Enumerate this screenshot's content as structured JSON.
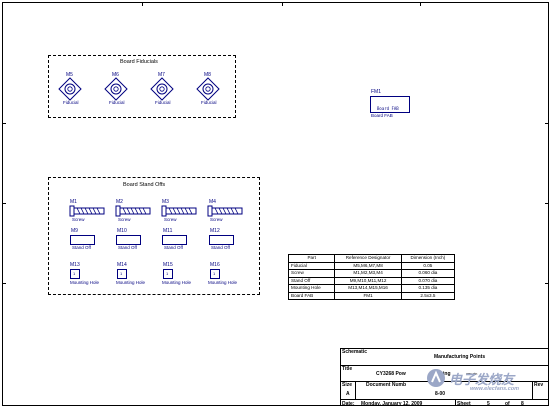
{
  "fiducials": {
    "title": "Board Fiducials",
    "items": [
      {
        "designator": "M5",
        "label": "Fiducial"
      },
      {
        "designator": "M6",
        "label": "Fiducial"
      },
      {
        "designator": "M7",
        "label": "Fiducial"
      },
      {
        "designator": "M8",
        "label": "Fiducial"
      }
    ]
  },
  "fab": {
    "designator": "FM1",
    "inner_label": "Board FAB",
    "label": "Board FAB"
  },
  "standoffs": {
    "title": "Board Stand Offs",
    "screws": [
      {
        "designator": "M1",
        "label": "Screw"
      },
      {
        "designator": "M2",
        "label": "Screw"
      },
      {
        "designator": "M3",
        "label": "Screw"
      },
      {
        "designator": "M4",
        "label": "Screw"
      }
    ],
    "stand_offs": [
      {
        "designator": "M9",
        "label": "Stand Off"
      },
      {
        "designator": "M10",
        "label": "Stand Off"
      },
      {
        "designator": "M11",
        "label": "Stand Off"
      },
      {
        "designator": "M12",
        "label": "Stand Off"
      }
    ],
    "holes": [
      {
        "designator": "M13",
        "label": "Mounting Hole",
        "pin": "1"
      },
      {
        "designator": "M14",
        "label": "Mounting Hole",
        "pin": "1"
      },
      {
        "designator": "M15",
        "label": "Mounting Hole",
        "pin": "1"
      },
      {
        "designator": "M16",
        "label": "Mounting Hole",
        "pin": "1"
      }
    ]
  },
  "table": {
    "headers": [
      "Part",
      "Reference Designator",
      "Dimension (Inch)"
    ],
    "rows": [
      [
        "Fiducial",
        "M5,M6,M7,M8",
        "0.05"
      ],
      [
        "Screw",
        "M1,M2,M3,M4",
        "0.060 dia"
      ],
      [
        "Stand Off",
        "M9,M10,M11,M12",
        "0.070 dia"
      ],
      [
        "Mounting Hole",
        "M13,M14,M15,M16",
        "0.135 dia"
      ],
      [
        "Board FAB",
        "FM1",
        "2.5x3.5"
      ]
    ]
  },
  "title_block": {
    "schematic_label": "Schematic",
    "schematic_value": "Manufacturing Points",
    "title_label": "Title",
    "title_value_left": "CY3268 Pow",
    "title_value_right": "ing",
    "title_value_small": "wer pin",
    "size_label": "Size",
    "size_value": "A",
    "doc_label": "Document Numb",
    "doc_value": "8-00",
    "rev_label": "Rev",
    "date_label": "Date:",
    "date_value": "Monday, January 12, 2009",
    "sheet_label": "Sheet",
    "sheet_value": "5",
    "of_label": "of",
    "of_value": "8"
  },
  "watermark": {
    "text": "电子发烧友",
    "sub": "www.elecfans.com"
  }
}
